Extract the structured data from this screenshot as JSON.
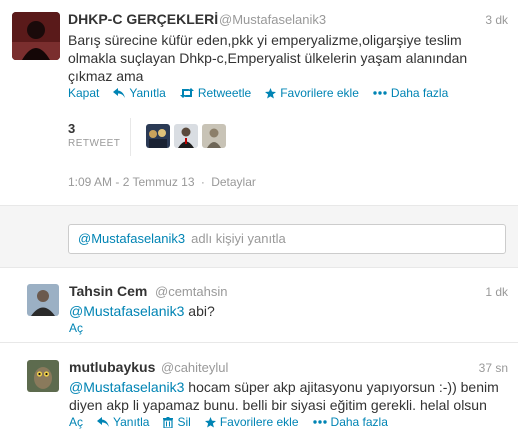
{
  "main_tweet": {
    "name": "DHKP-C GERÇEKLERİ",
    "handle": "@Mustafaselanik3",
    "time": "3 dk",
    "text_lines": [
      "Barış sürecine küfür eden,pkk yi emperyalizme,oligarşiye teslim",
      "olmakla suçlayan Dhkp-c,Emperyalist ülkelerin yaşam alanından",
      "çıkmaz ama"
    ],
    "actions": {
      "close": "Kapat",
      "reply": "Yanıtla",
      "retweet": "Retweetle",
      "favorite": "Favorilere ekle",
      "more": "Daha fazla"
    },
    "retweet_count": "3",
    "retweet_label": "RETWEET",
    "timestamp": "1:09 AM - 2 Temmuz 13",
    "details": "Detaylar"
  },
  "reply_box": {
    "mention": "@Mustafaselanik3",
    "placeholder": "adlı kişiyi yanıtla"
  },
  "replies": [
    {
      "name": "Tahsin Cem",
      "handle": "@cemtahsin",
      "time": "1 dk",
      "mention": "@Mustafaselanik3",
      "text": "abi?",
      "open": "Aç"
    },
    {
      "name": "mutlubaykus",
      "handle": "@cahiteylul",
      "time": "37 sn",
      "mention": "@Mustafaselanik3",
      "text_line1": "hocam süper akp ajitasyonu yapıyorsun :-)) benim",
      "text_line2": "diyen akp li yapamaz bunu.  belli bir siyasi eğitim gerekli. helal olsun",
      "actions": {
        "open": "Aç",
        "reply": "Yanıtla",
        "delete": "Sil",
        "favorite": "Favorilere ekle",
        "more": "Daha fazla"
      }
    }
  ],
  "colors": {
    "link": "#0084b4",
    "text": "#333333",
    "muted": "#999999",
    "border": "#e8e8e8",
    "reply_bg": "#f5f5f5"
  }
}
